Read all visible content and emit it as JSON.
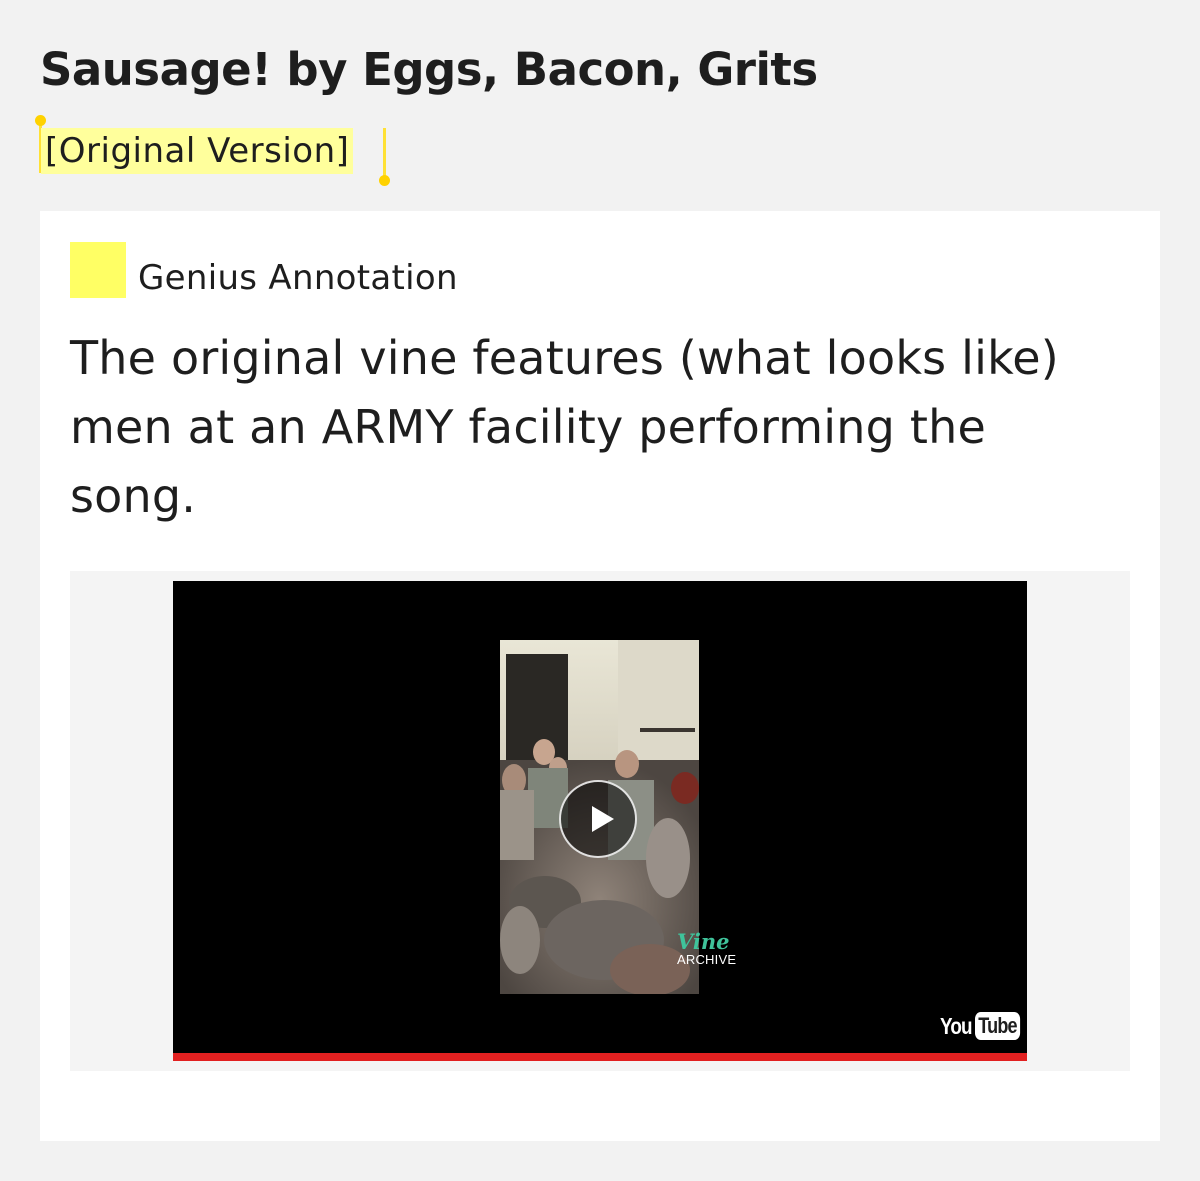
{
  "song": {
    "title": "Sausage! by Eggs, Bacon, Grits"
  },
  "highlight": {
    "text": "[Original Version]",
    "color": "#ffff9c"
  },
  "annotation": {
    "label": "Genius Annotation",
    "body": "The original vine features (what looks like) men at an ARMY facility performing the song.",
    "label_color": "#ffff64"
  },
  "embed": {
    "provider": "YouTube",
    "logo_you": "You",
    "logo_tube": "Tube",
    "watermark_word": "Vine",
    "watermark_sub": "ARCHIVE",
    "watermark_color": "#3fc39b",
    "progress": 1.0,
    "progress_color": "#e12020",
    "play_icon": "play-icon"
  }
}
